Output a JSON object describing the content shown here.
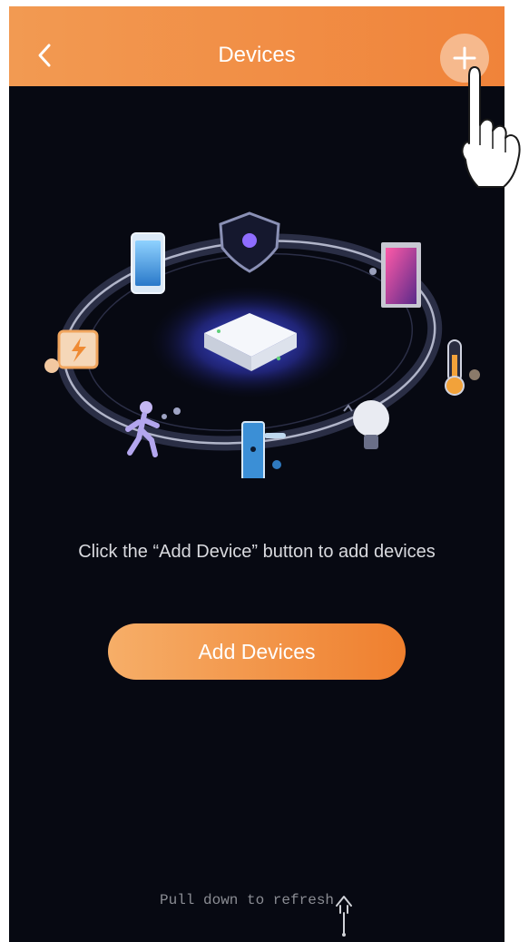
{
  "header": {
    "title": "Devices",
    "back_icon": "chevron-left-icon",
    "add_icon": "plus-icon",
    "colors": {
      "start": "#f29a52",
      "end": "#f0833a"
    }
  },
  "illustration": {
    "center_device": "smart-hub-icon",
    "devices": [
      "smartphone-icon",
      "shield-icon",
      "door-sensor-icon",
      "thermometer-icon",
      "light-bulb-icon",
      "smart-lock-icon",
      "motion-person-icon",
      "smart-switch-icon"
    ]
  },
  "empty_state": {
    "message": "Click the “Add Device” button to add devices"
  },
  "actions": {
    "add_devices_label": "Add Devices"
  },
  "footer": {
    "pull_text": "Pull down to refresh"
  },
  "overlay": {
    "hand_icon": "pointing-hand-icon"
  }
}
